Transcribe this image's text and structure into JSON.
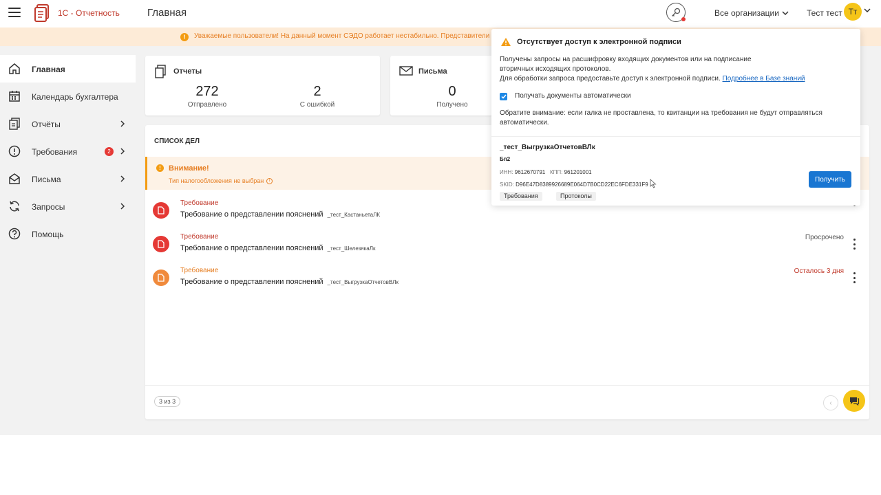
{
  "header": {
    "logo_text": "1С - Отчетность",
    "page_title": "Главная",
    "org_select": "Все организации",
    "user_name": "Тест тест",
    "avatar_initials": "Тт"
  },
  "banner": {
    "text": "Уважаемые пользователи! На данный момент СЭДО работает нестабильно. Представители СФР"
  },
  "sidebar": {
    "items": [
      {
        "label": "Главная"
      },
      {
        "label": "Календарь бухгалтера"
      },
      {
        "label": "Отчёты"
      },
      {
        "label": "Требования",
        "badge": "2"
      },
      {
        "label": "Письма"
      },
      {
        "label": "Запросы"
      },
      {
        "label": "Помощь"
      }
    ]
  },
  "cards": {
    "reports": {
      "title": "Отчеты",
      "sent_value": "272",
      "sent_label": "Отправлено",
      "error_value": "2",
      "error_label": "С ошибкой"
    },
    "letters": {
      "title": "Письма",
      "received_value": "0",
      "received_label": "Получено"
    }
  },
  "tasks": {
    "title": "СПИСОК ДЕЛ",
    "alert": {
      "title": "Внимание!",
      "text": "Тип налогообложения не выбран"
    },
    "rows": [
      {
        "type": "Требование",
        "title": "Требование о представлении пояснений",
        "org": "_тест_КастаньетаЛК",
        "status": ""
      },
      {
        "type": "Требование",
        "title": "Требование о представлении пояснений",
        "org": "_тест_ШелезякаЛк",
        "status": "Просрочено"
      },
      {
        "type": "Требование",
        "title": "Требование о представлении пояснений",
        "org": "_тест_ВыгрузкаОтчетовВЛк",
        "status": "Осталось 3 дня"
      }
    ],
    "pager": "3 из 3"
  },
  "popup": {
    "title": "Отсутствует доступ к электронной подписи",
    "line1": "Получены запросы на расшифровку входящих документов или на подписание",
    "line2": "вторичных исходящих протоколов.",
    "line3": "Для обработки запроса предоставьте доступ к электронной подписи.",
    "link": "Подробнее в Базе знаний",
    "checkbox_label": "Получать документы автоматически",
    "note1": "Обратите внимание: если галка не проставлена, то квитанции на требования не будут отправляться",
    "note2": "автоматически.",
    "org_name": "_тест_ВыгрузкаОтчетовВЛк",
    "org_sub": "Бп2",
    "inn_label": "ИНН:",
    "inn": "9612670791",
    "kpp_label": "КПП:",
    "kpp": "961201001",
    "skid_label": "SKID:",
    "skid": "D96E47D8389926689E064D7B0CD22EC6FDE331F9",
    "tag1": "Требования",
    "tag2": "Протоколы",
    "button": "Получить"
  },
  "colors": {
    "accent_red": "#c0392b",
    "warning_orange": "#e67e22",
    "primary_blue": "#1976d2",
    "avatar_yellow": "#f5c518",
    "task_red": "#e53935",
    "task_orange": "#f08a3c"
  },
  "icons": {
    "menu": "hamburger-icon",
    "key": "key-icon",
    "chat": "chat-icon",
    "warning": "warning-icon"
  }
}
